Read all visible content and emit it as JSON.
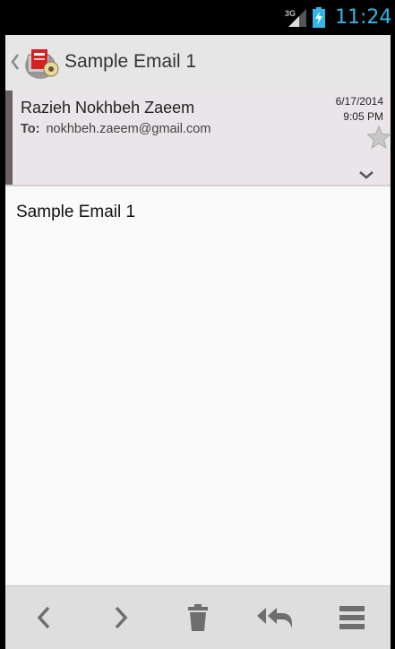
{
  "status_bar": {
    "network_label": "3G",
    "time": "11:24",
    "time_color": "#33b5e5",
    "icons": [
      "signal-icon",
      "battery-charging-icon"
    ]
  },
  "action_bar": {
    "title": "Sample Email 1",
    "icons": [
      "up-chevron-icon",
      "app-icon"
    ]
  },
  "message_header": {
    "sender": "Razieh Nokhbeh Zaeem",
    "to_label": "To:",
    "to_address": "nokhbeh.zaeem@gmail.com",
    "date": "6/17/2014",
    "time": "9:05 PM",
    "icons": [
      "star-icon",
      "expand-icon"
    ],
    "strip_color": "#6a6261"
  },
  "message_body": {
    "text": "Sample Email 1"
  },
  "bottom_bar": {
    "buttons": [
      "previous-icon",
      "next-icon",
      "delete-icon",
      "reply-all-icon",
      "menu-icon"
    ]
  }
}
